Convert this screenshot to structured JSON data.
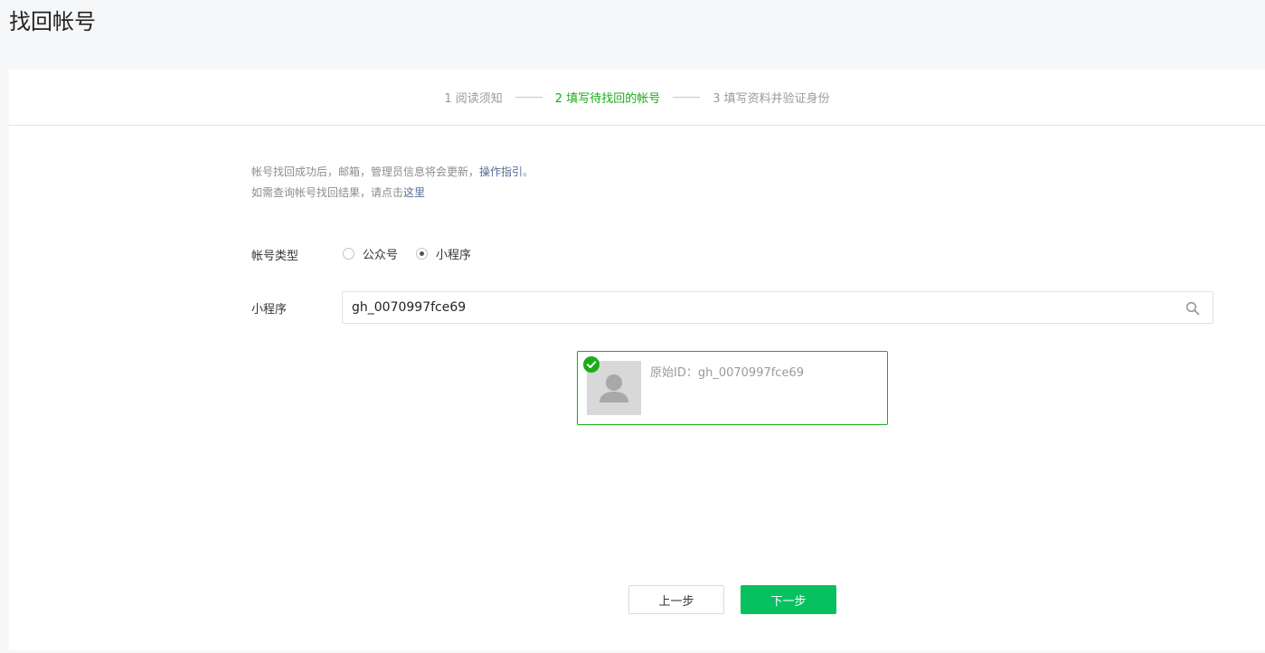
{
  "page": {
    "title": "找回帐号"
  },
  "steps": [
    {
      "label": "1 阅读须知",
      "state": "done"
    },
    {
      "label": "2 填写待找回的帐号",
      "state": "active"
    },
    {
      "label": "3 填写资料并验证身份",
      "state": "pending"
    }
  ],
  "notice": {
    "line1_text": "帐号找回成功后，邮箱，管理员信息将会更新，",
    "line1_link": "操作指引",
    "line1_end": "。",
    "line2_text": "如需查询帐号找回结果，请点击",
    "line2_link": "这里"
  },
  "account_type": {
    "label": "帐号类型",
    "options": [
      {
        "label": "公众号",
        "selected": false
      },
      {
        "label": "小程序",
        "selected": true
      }
    ]
  },
  "mini_program": {
    "label": "小程序",
    "input_value": "gh_0070997fce69"
  },
  "result": {
    "original_id": "原始ID：gh_0070997fce69",
    "selected": true
  },
  "buttons": {
    "prev_label": "上一步",
    "next_label": "下一步"
  },
  "colors": {
    "accent_green": "#1aad19",
    "primary_button": "#07c160",
    "link": "#576b95"
  }
}
